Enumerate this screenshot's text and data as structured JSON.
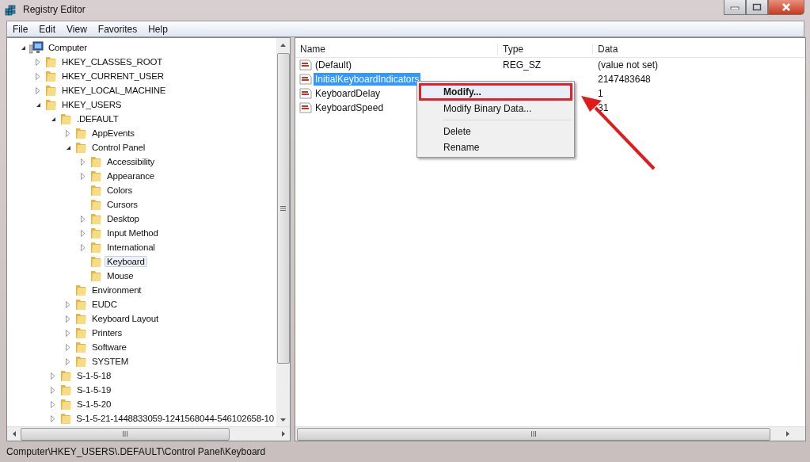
{
  "window": {
    "title": "Registry Editor"
  },
  "menu": [
    "File",
    "Edit",
    "View",
    "Favorites",
    "Help"
  ],
  "tree": [
    {
      "label": "Computer",
      "kind": "computer",
      "expanded": true,
      "selected": false,
      "children": [
        {
          "label": "HKEY_CLASSES_ROOT",
          "expanded": false,
          "selected": false
        },
        {
          "label": "HKEY_CURRENT_USER",
          "expanded": false,
          "selected": false
        },
        {
          "label": "HKEY_LOCAL_MACHINE",
          "expanded": false,
          "selected": false
        },
        {
          "label": "HKEY_USERS",
          "expanded": true,
          "selected": false,
          "children": [
            {
              "label": ".DEFAULT",
              "expanded": true,
              "selected": false,
              "children": [
                {
                  "label": "AppEvents",
                  "expanded": false,
                  "selected": false
                },
                {
                  "label": "Control Panel",
                  "expanded": true,
                  "selected": false,
                  "children": [
                    {
                      "label": "Accessibility",
                      "expanded": false,
                      "selected": false
                    },
                    {
                      "label": "Appearance",
                      "expanded": false,
                      "selected": false
                    },
                    {
                      "label": "Colors",
                      "selected": false
                    },
                    {
                      "label": "Cursors",
                      "selected": false
                    },
                    {
                      "label": "Desktop",
                      "expanded": false,
                      "selected": false
                    },
                    {
                      "label": "Input Method",
                      "expanded": false,
                      "selected": false
                    },
                    {
                      "label": "International",
                      "expanded": false,
                      "selected": false
                    },
                    {
                      "label": "Keyboard",
                      "selected": true
                    },
                    {
                      "label": "Mouse",
                      "selected": false
                    }
                  ]
                },
                {
                  "label": "Environment",
                  "selected": false
                },
                {
                  "label": "EUDC",
                  "expanded": false,
                  "selected": false
                },
                {
                  "label": "Keyboard Layout",
                  "expanded": false,
                  "selected": false
                },
                {
                  "label": "Printers",
                  "expanded": false,
                  "selected": false
                },
                {
                  "label": "Software",
                  "expanded": false,
                  "selected": false
                },
                {
                  "label": "SYSTEM",
                  "expanded": false,
                  "selected": false
                }
              ]
            },
            {
              "label": "S-1-5-18",
              "expanded": false,
              "selected": false
            },
            {
              "label": "S-1-5-19",
              "expanded": false,
              "selected": false
            },
            {
              "label": "S-1-5-20",
              "expanded": false,
              "selected": false
            },
            {
              "label": "S-1-5-21-1448833059-1241568044-546102658-10",
              "expanded": false,
              "selected": false
            }
          ]
        }
      ]
    }
  ],
  "columns": [
    "Name",
    "Type",
    "Data"
  ],
  "values": [
    {
      "name": "(Default)",
      "type": "REG_SZ",
      "data": "(value not set)",
      "selected": false
    },
    {
      "name": "InitialKeyboardIndicators",
      "data": "2147483648",
      "selected": true
    },
    {
      "name": "KeyboardDelay",
      "data": "1",
      "selected": false
    },
    {
      "name": "KeyboardSpeed",
      "data": "31",
      "selected": false
    }
  ],
  "context_menu": [
    {
      "kind": "item",
      "label": "Modify...",
      "bold": true,
      "highlighted": true
    },
    {
      "kind": "item",
      "label": "Modify Binary Data...",
      "bold": false,
      "highlighted": false
    },
    {
      "kind": "separator"
    },
    {
      "kind": "item",
      "label": "Delete",
      "bold": false,
      "highlighted": false
    },
    {
      "kind": "item",
      "label": "Rename",
      "bold": false,
      "highlighted": false
    }
  ],
  "status_bar": "Computer\\HKEY_USERS\\.DEFAULT\\Control Panel\\Keyboard"
}
